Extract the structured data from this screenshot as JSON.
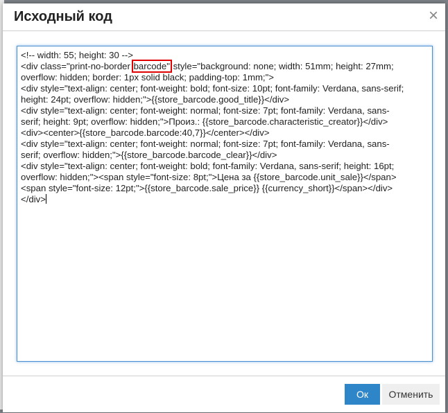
{
  "dialog": {
    "title": "Исходный код",
    "close_icon": "×",
    "ok_label": "Ок",
    "cancel_label": "Отменить"
  },
  "code": {
    "line1": "<!-- width: 55; height: 30 -->",
    "line2_pre": "<div class=\"print-no-border",
    "line2_highlight": "barcode\"",
    "line2_post": "style=\"background: none; width: 51mm; height: 27mm;",
    "lines": [
      "overflow: hidden; border: 1px solid black; padding-top: 1mm;\">",
      "<div style=\"text-align: center; font-weight: bold; font-size: 10pt; font-family: Verdana, sans-serif;",
      "height: 24pt; overflow: hidden;\">{{store_barcode.good_title}}</div>",
      "<div style=\"text-align: center; font-weight: normal; font-size: 7pt; font-family: Verdana, sans-",
      "serif; height: 9pt; overflow: hidden;\">Произ.: {{store_barcode.characteristic_creator}}</div>",
      "<div><center>{{store_barcode.barcode:40,7}}</center></div>",
      "<div style=\"text-align: center; font-weight: normal; font-size: 7pt; font-family: Verdana, sans-",
      "serif; overflow: hidden;\">{{store_barcode.barcode_clear}}</div>",
      "<div style=\"text-align: center; font-weight: bold; font-family: Verdana, sans-serif; height: 16pt;",
      "overflow: hidden;\"><span style=\"font-size: 8pt;\">Цена за {{store_barcode.unit_sale}}</span>",
      "<span style=\"font-size: 12pt;\">{{store_barcode.sale_price}} {{currency_short}}</span></div>",
      "</div>"
    ]
  },
  "colors": {
    "accent": "#2e86c9",
    "highlight": "#e00000"
  }
}
